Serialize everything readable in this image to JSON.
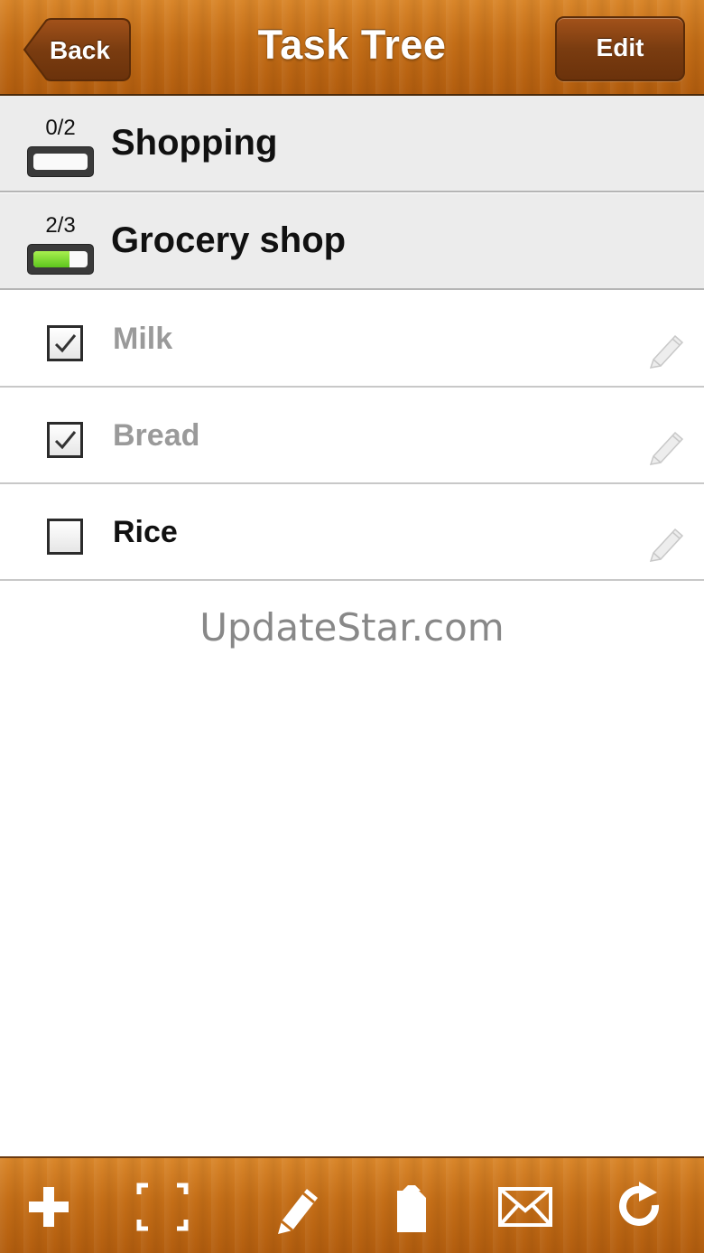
{
  "header": {
    "title": "Task Tree",
    "back_label": "Back",
    "edit_label": "Edit"
  },
  "groups": [
    {
      "label": "Shopping",
      "count": "0/2",
      "progress": 0
    },
    {
      "label": "Grocery shop",
      "count": "2/3",
      "progress": 0.67
    }
  ],
  "tasks": [
    {
      "label": "Milk",
      "checked": true,
      "icon": "pencil-icon"
    },
    {
      "label": "Bread",
      "checked": true,
      "icon": "pencil-icon"
    },
    {
      "label": "Rice",
      "checked": false,
      "icon": "pencil-icon"
    }
  ],
  "watermark": "UpdateStar.com",
  "toolbar": {
    "icons": [
      "plus-icon",
      "expand-icon",
      "pencil-icon",
      "clipboard-icon",
      "mail-icon",
      "refresh-icon"
    ]
  },
  "colors": {
    "wood": "#c46e17",
    "progress_green": "#5dc61d"
  }
}
